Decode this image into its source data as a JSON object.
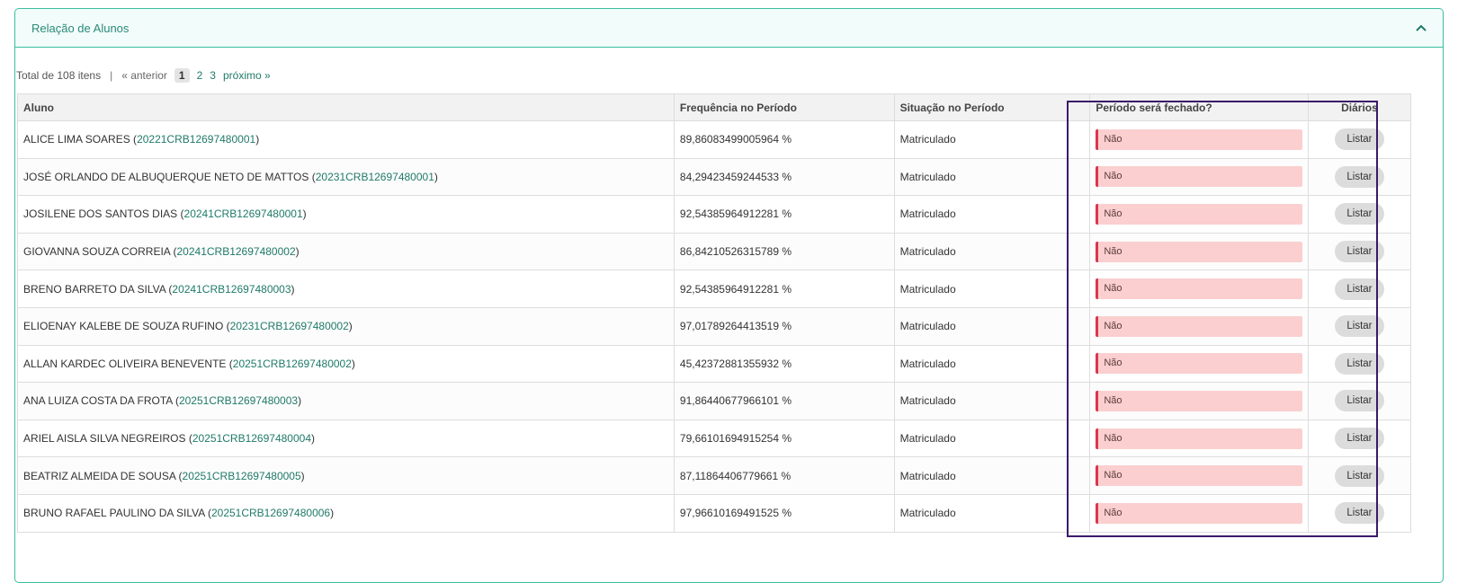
{
  "panel": {
    "title": "Relação de Alunos",
    "toggle_icon": "chevron-up-icon"
  },
  "pager": {
    "total": "Total de 108 itens",
    "separator": "|",
    "prev": "« anterior",
    "pages": [
      "1",
      "2",
      "3"
    ],
    "current": "1",
    "next": "próximo »"
  },
  "table": {
    "headers": {
      "aluno": "Aluno",
      "frequencia": "Frequência no Período",
      "situacao": "Situação no Período",
      "fechado": "Período será fechado?",
      "diarios": "Diários"
    },
    "rows": [
      {
        "name": "ALICE LIMA SOARES",
        "matricula": "20221CRB12697480001",
        "frequencia": "89,86083499005964 %",
        "situacao": "Matriculado",
        "fechado": "Não",
        "action": "Listar"
      },
      {
        "name": "JOSÉ ORLANDO DE ALBUQUERQUE NETO DE MATTOS",
        "matricula": "20231CRB12697480001",
        "frequencia": "84,29423459244533 %",
        "situacao": "Matriculado",
        "fechado": "Não",
        "action": "Listar"
      },
      {
        "name": "JOSILENE DOS SANTOS DIAS",
        "matricula": "20241CRB12697480001",
        "frequencia": "92,54385964912281 %",
        "situacao": "Matriculado",
        "fechado": "Não",
        "action": "Listar"
      },
      {
        "name": "GIOVANNA SOUZA CORREIA",
        "matricula": "20241CRB12697480002",
        "frequencia": "86,84210526315789 %",
        "situacao": "Matriculado",
        "fechado": "Não",
        "action": "Listar"
      },
      {
        "name": "BRENO BARRETO DA SILVA",
        "matricula": "20241CRB12697480003",
        "frequencia": "92,54385964912281 %",
        "situacao": "Matriculado",
        "fechado": "Não",
        "action": "Listar"
      },
      {
        "name": "ELIOENAY KALEBE DE SOUZA RUFINO",
        "matricula": "20231CRB12697480002",
        "frequencia": "97,01789264413519 %",
        "situacao": "Matriculado",
        "fechado": "Não",
        "action": "Listar"
      },
      {
        "name": "ALLAN KARDEC OLIVEIRA BENEVENTE",
        "matricula": "20251CRB12697480002",
        "frequencia": "45,42372881355932 %",
        "situacao": "Matriculado",
        "fechado": "Não",
        "action": "Listar"
      },
      {
        "name": "ANA LUIZA COSTA DA FROTA",
        "matricula": "20251CRB12697480003",
        "frequencia": "91,86440677966101 %",
        "situacao": "Matriculado",
        "fechado": "Não",
        "action": "Listar"
      },
      {
        "name": "ARIEL AISLA SILVA NEGREIROS",
        "matricula": "20251CRB12697480004",
        "frequencia": "79,66101694915254 %",
        "situacao": "Matriculado",
        "fechado": "Não",
        "action": "Listar"
      },
      {
        "name": "BEATRIZ ALMEIDA DE SOUSA",
        "matricula": "20251CRB12697480005",
        "frequencia": "87,11864406779661 %",
        "situacao": "Matriculado",
        "fechado": "Não",
        "action": "Listar"
      },
      {
        "name": "BRUNO RAFAEL PAULINO DA SILVA",
        "matricula": "20251CRB12697480006",
        "frequencia": "97,96610169491525 %",
        "situacao": "Matriculado",
        "fechado": "Não",
        "action": "Listar"
      }
    ]
  },
  "colors": {
    "accent": "#3bbf9f",
    "link": "#1f7a68",
    "badge_bg": "#fbcfcf",
    "badge_border": "#d9354f",
    "highlight_border": "#3a1a6b"
  }
}
